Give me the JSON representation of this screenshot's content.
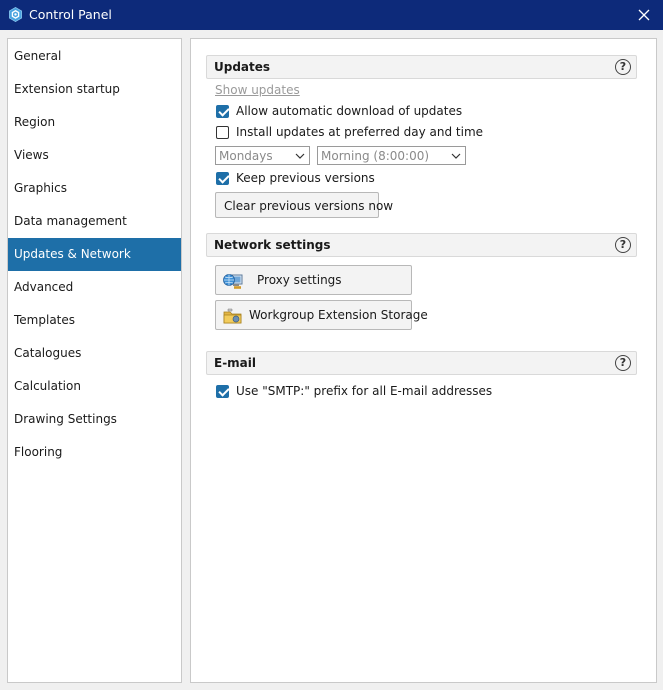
{
  "window": {
    "title": "Control Panel"
  },
  "sidebar": {
    "items": [
      {
        "label": "General"
      },
      {
        "label": "Extension startup"
      },
      {
        "label": "Region"
      },
      {
        "label": "Views"
      },
      {
        "label": "Graphics"
      },
      {
        "label": "Data management"
      },
      {
        "label": "Updates & Network",
        "selected": true
      },
      {
        "label": "Advanced"
      },
      {
        "label": "Templates"
      },
      {
        "label": "Catalogues"
      },
      {
        "label": "Calculation"
      },
      {
        "label": "Drawing Settings"
      },
      {
        "label": "Flooring"
      }
    ]
  },
  "updates": {
    "title": "Updates",
    "help": "?",
    "show_updates_link": "Show updates",
    "auto_download": {
      "label": "Allow automatic download of updates",
      "checked": true
    },
    "preferred_time": {
      "label": "Install updates at preferred day and time",
      "checked": false
    },
    "day_select": {
      "value": "Mondays"
    },
    "time_select": {
      "value": "Morning (8:00:00)"
    },
    "keep_versions": {
      "label": "Keep previous versions",
      "checked": true
    },
    "clear_button": "Clear previous versions now"
  },
  "network": {
    "title": "Network settings",
    "help": "?",
    "proxy_button": "Proxy settings",
    "proxy_icon": "network-globe-icon",
    "storage_button": "Workgroup Extension Storage",
    "storage_icon": "folder-icon"
  },
  "email": {
    "title": "E-mail",
    "help": "?",
    "smtp_prefix": {
      "label": "Use \"SMTP:\" prefix for all E-mail addresses",
      "checked": true
    }
  },
  "colors": {
    "titlebar": "#0d2a7a",
    "selected": "#1e6fa8",
    "checkbox": "#1e6fa8"
  }
}
